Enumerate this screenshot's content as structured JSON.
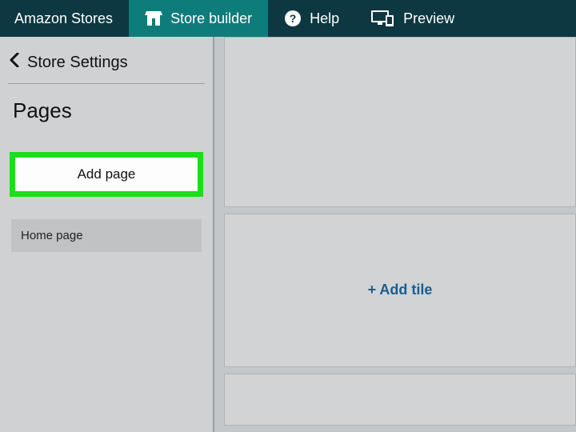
{
  "topnav": {
    "brand": "Amazon Stores",
    "store_builder": "Store builder",
    "help": "Help",
    "preview": "Preview"
  },
  "sidebar": {
    "store_settings": "Store Settings",
    "pages_title": "Pages",
    "add_page_label": "Add page",
    "pages": [
      {
        "label": "Home page"
      }
    ]
  },
  "canvas": {
    "add_tile_label": "+ Add tile"
  }
}
